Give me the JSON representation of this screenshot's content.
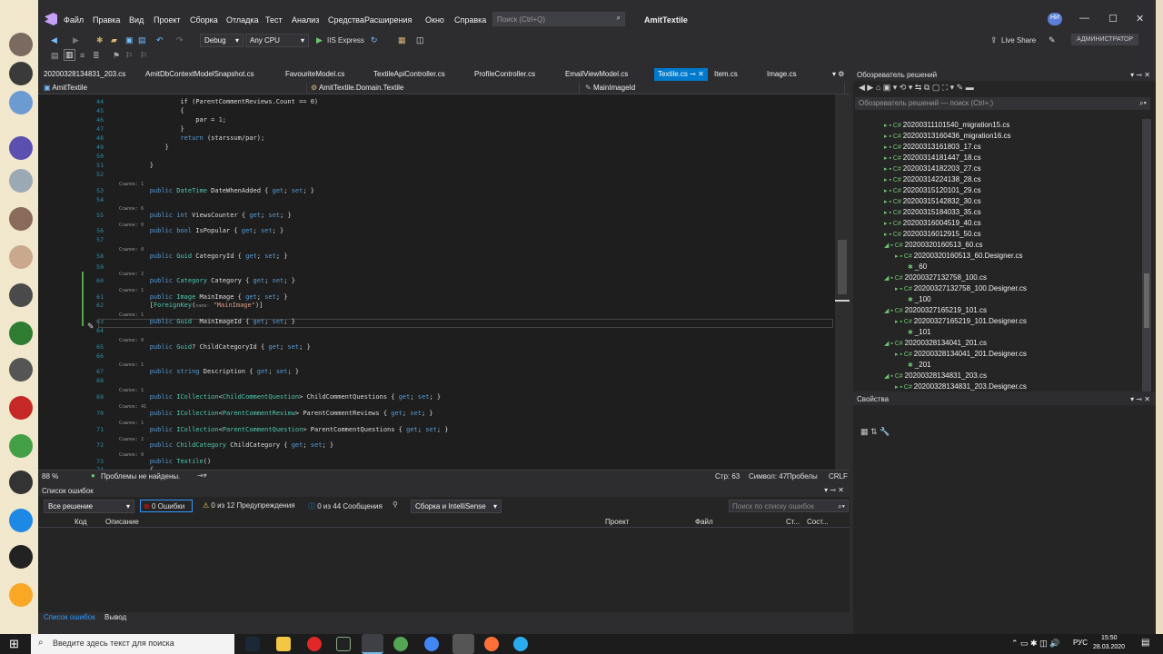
{
  "titlebar": {
    "menu": [
      "Файл",
      "Правка",
      "Вид",
      "Проект",
      "Сборка",
      "Отладка",
      "Тест",
      "Анализ",
      "Средства",
      "Расширения",
      "Окно",
      "Справка"
    ],
    "search_placeholder": "Поиск (Ctrl+Q)",
    "solution_name": "AmitTextile",
    "avatar_initials": "НИ"
  },
  "toolbar": {
    "config": "Debug",
    "platform": "Any CPU",
    "run_target": "IIS Express",
    "live_share": "Live Share",
    "admin_badge": "АДМИНИСТРАТОР"
  },
  "tabs": [
    "20200328134831_203.cs",
    "AmitDbContextModelSnapshot.cs",
    "FavouriteModel.cs",
    "TextileApiController.cs",
    "ProfileController.cs",
    "EmailViewModel.cs",
    "Textile.cs",
    "Item.cs",
    "Image.cs"
  ],
  "navbar": {
    "project": "AmitTextile",
    "class": "AmitTextile.Domain.Textile",
    "member": "MainImageId"
  },
  "editor_status": {
    "zoom": "88 %",
    "issues": "Проблемы не найдены.",
    "line": "Стр: 63",
    "char": "Символ: 47",
    "spaces": "Пробелы",
    "eol": "CRLF"
  },
  "error_list": {
    "title": "Список ошибок",
    "scope": "Все решение",
    "errors": "0 Ошибки",
    "warnings": "0 из 12 Предупреждения",
    "messages": "0 из 44 Сообщения",
    "build_filter": "Сборка и IntelliSense",
    "search_placeholder": "Поиск по списку ошибок",
    "columns": [
      "Код",
      "Описание",
      "Проект",
      "Файл",
      "Ст...",
      "Сост..."
    ]
  },
  "bottom_tabs": [
    "Список ошибок",
    "Вывод"
  ],
  "solution_explorer": {
    "title": "Обозреватель решений",
    "search_placeholder": "Обозреватель решений — поиск (Ctrl+;)",
    "items": [
      "20200311101540_migration15.cs",
      "20200313160436_migration16.cs",
      "20200313161803_17.cs",
      "20200314181447_18.cs",
      "20200314182203_27.cs",
      "20200314224138_28.cs",
      "20200315120101_29.cs",
      "20200315142832_30.cs",
      "20200315184033_35.cs",
      "20200316004519_40.cs",
      "20200316012915_50.cs",
      "20200320160513_60.cs",
      "20200320160513_60.Designer.cs",
      "_60",
      "20200327132758_100.cs",
      "20200327132758_100.Designer.cs",
      "_100",
      "20200327165219_101.cs",
      "20200327165219_101.Designer.cs",
      "_101",
      "20200328134041_201.cs",
      "20200328134041_201.Designer.cs",
      "_201",
      "20200328134831_203.cs",
      "20200328134831_203.Designer.cs"
    ]
  },
  "properties": {
    "title": "Свойства"
  },
  "code": {
    "refs": [
      "Ссылок: 1",
      "Ссылок: 6",
      "Ссылок: 0",
      "Ссылок: 0",
      "Ссылок: 2",
      "Ссылок: 1",
      "Ссылок: 1",
      "Ссылок: 0",
      "Ссылок: 1",
      "Ссылок: 1",
      "Ссылок: 41",
      "Ссылок: 1",
      "Ссылок: 2",
      "Ссылок: 0"
    ],
    "line_numbers": [
      "44",
      "45",
      "46",
      "47",
      "48",
      "49",
      "50",
      "51",
      "52",
      "53",
      "54",
      "55",
      "56",
      "57",
      "58",
      "59",
      "60",
      "61",
      "62",
      "63",
      "64",
      "65",
      "66",
      "67",
      "68",
      "69",
      "70",
      "71",
      "72",
      "73",
      "74"
    ]
  },
  "taskbar": {
    "search_placeholder": "Введите здесь текст для поиска",
    "lang": "РУС",
    "time": "15:50",
    "date": "28.03.2020"
  },
  "colors": {
    "accent": "#007acc",
    "bg": "#2d2d30",
    "editor": "#1e1e1e",
    "keyword": "#569cd6",
    "type": "#4ec9b0"
  }
}
